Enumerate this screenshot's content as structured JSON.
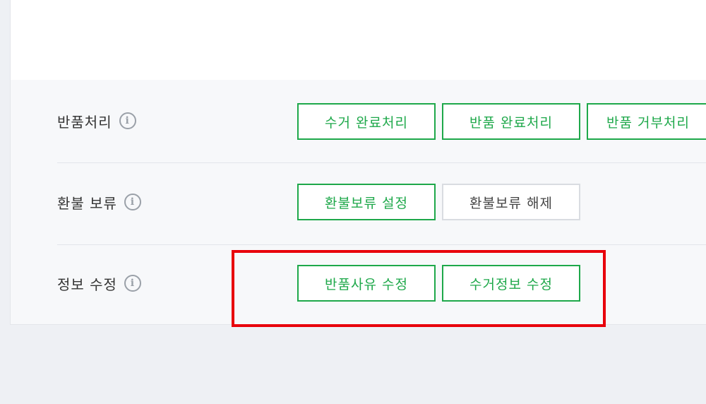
{
  "rows": {
    "return_processing": {
      "label": "반품처리",
      "buttons": [
        "수거 완료처리",
        "반품 완료처리",
        "반품 거부처리"
      ]
    },
    "refund_hold": {
      "label": "환불 보류",
      "buttons": [
        "환불보류 설정",
        "환불보류 해제"
      ]
    },
    "info_edit": {
      "label": "정보 수정",
      "buttons": [
        "반품사유 수정",
        "수거정보 수정"
      ]
    }
  },
  "icons": {
    "info": "info-circle-icon",
    "info_glyph": "i"
  },
  "colors": {
    "accent": "#1ea84a",
    "highlight": "#e8000b",
    "neutral_border": "#d9dce1"
  }
}
